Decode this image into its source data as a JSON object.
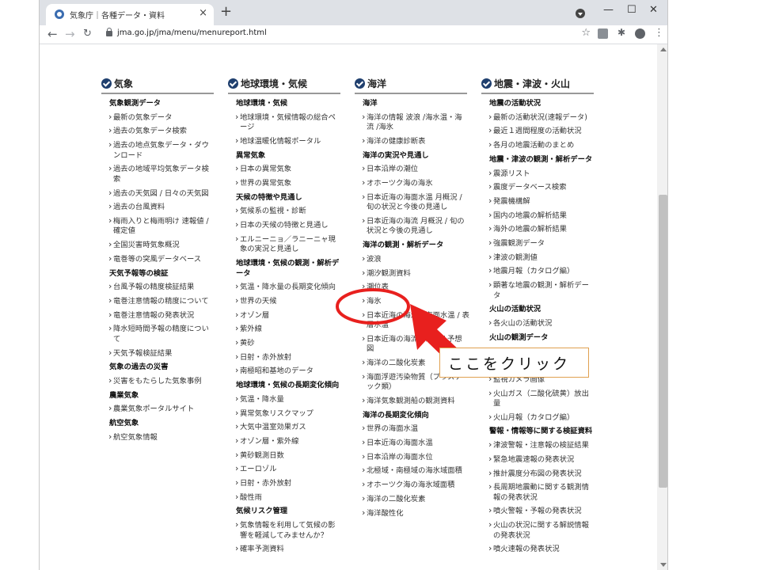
{
  "browser": {
    "tab_title": "気象庁｜各種データ・資料",
    "tab_close": "×",
    "new_tab": "+",
    "url": "jma.go.jp/jma/menu/menureport.html",
    "controls": {
      "minimize": "—",
      "maximize": "☐",
      "close": "✕"
    },
    "nav": {
      "back": "←",
      "forward": "→",
      "reload": "C"
    },
    "star": "☆",
    "menu": "⋮",
    "puzzle": "✱"
  },
  "columns": [
    {
      "title": "気象",
      "items": [
        {
          "type": "cat",
          "text": "気象観測データ"
        },
        {
          "type": "link",
          "text": "最新の気象データ"
        },
        {
          "type": "link",
          "text": "過去の気象データ検索"
        },
        {
          "type": "link",
          "text": "過去の地点気象データ・ダウ"
        },
        {
          "type": "cont",
          "text": "ンロード"
        },
        {
          "type": "link",
          "text": "過去の地域平均気象データ検"
        },
        {
          "type": "cont",
          "text": "索"
        },
        {
          "type": "link",
          "text": "過去の天気図 / 日々の天気図"
        },
        {
          "type": "link",
          "text": "過去の台風資料"
        },
        {
          "type": "link",
          "text": "梅雨入りと梅雨明け 速報値 /"
        },
        {
          "type": "cont",
          "text": "確定値"
        },
        {
          "type": "link",
          "text": "全国災害時気象概況"
        },
        {
          "type": "link",
          "text": "竜巻等の突風データベース"
        },
        {
          "type": "cat",
          "text": "天気予報等の検証"
        },
        {
          "type": "link",
          "text": "台風予報の精度検証結果"
        },
        {
          "type": "link",
          "text": "竜巻注意情報の精度について"
        },
        {
          "type": "link",
          "text": "竜巻注意情報の発表状況"
        },
        {
          "type": "link",
          "text": "降水短時間予報の精度につい"
        },
        {
          "type": "cont",
          "text": "て"
        },
        {
          "type": "link",
          "text": "天気予報検証結果"
        },
        {
          "type": "cat",
          "text": "気象の過去の災害"
        },
        {
          "type": "link",
          "text": "災害をもたらした気象事例"
        },
        {
          "type": "cat",
          "text": "農業気象"
        },
        {
          "type": "link",
          "text": "農業気象ポータルサイト"
        },
        {
          "type": "cat",
          "text": "航空気象"
        },
        {
          "type": "link",
          "text": "航空気象情報"
        }
      ]
    },
    {
      "title": "地球環境・気候",
      "items": [
        {
          "type": "cat",
          "text": "地球環境・気候"
        },
        {
          "type": "link",
          "text": "地球環境・気候情報の総合ペ"
        },
        {
          "type": "cont",
          "text": "ージ"
        },
        {
          "type": "link",
          "text": "地球温暖化情報ポータル"
        },
        {
          "type": "cat",
          "text": "異常気象"
        },
        {
          "type": "link",
          "text": "日本の異常気象"
        },
        {
          "type": "link",
          "text": "世界の異常気象"
        },
        {
          "type": "cat",
          "text": "天候の特徴や見通し"
        },
        {
          "type": "link",
          "text": "気候系の監視・診断"
        },
        {
          "type": "link",
          "text": "日本の天候の特徴と見通し"
        },
        {
          "type": "link",
          "text": "エルニーニョ／ラニーニャ現"
        },
        {
          "type": "cont",
          "text": "象の実況と見通し"
        },
        {
          "type": "cat",
          "text": "地球環境・気候の観測・解析デ"
        },
        {
          "type": "catc",
          "text": "ータ"
        },
        {
          "type": "link",
          "text": "気温・降水量の長期変化傾向"
        },
        {
          "type": "link",
          "text": "世界の天候"
        },
        {
          "type": "link",
          "text": "オゾン層"
        },
        {
          "type": "link",
          "text": "紫外線"
        },
        {
          "type": "link",
          "text": "黄砂"
        },
        {
          "type": "link",
          "text": "日射・赤外放射"
        },
        {
          "type": "link",
          "text": "南極昭和基地のデータ"
        },
        {
          "type": "cat",
          "text": "地球環境・気候の長期変化傾向"
        },
        {
          "type": "link",
          "text": "気温・降水量"
        },
        {
          "type": "link",
          "text": "異常気象リスクマップ"
        },
        {
          "type": "link",
          "text": "大気中温室効果ガス"
        },
        {
          "type": "link",
          "text": "オゾン層・紫外線"
        },
        {
          "type": "link",
          "text": "黄砂観測日数"
        },
        {
          "type": "link",
          "text": "エーロゾル"
        },
        {
          "type": "link",
          "text": "日射・赤外放射"
        },
        {
          "type": "link",
          "text": "酸性雨"
        },
        {
          "type": "cat",
          "text": "気候リスク管理"
        },
        {
          "type": "link",
          "text": "気象情報を利用して気候の影"
        },
        {
          "type": "cont",
          "text": "響を軽減してみませんか？"
        },
        {
          "type": "link",
          "text": "確率予測資料"
        }
      ]
    },
    {
      "title": "海洋",
      "items": [
        {
          "type": "cat",
          "text": "海洋"
        },
        {
          "type": "link",
          "text": "海洋の情報 波浪 /海水温・海"
        },
        {
          "type": "cont",
          "text": "流 /海氷"
        },
        {
          "type": "link",
          "text": "海洋の健康診断表"
        },
        {
          "type": "cat",
          "text": "海洋の実況や見通し"
        },
        {
          "type": "link",
          "text": "日本沿岸の潮位"
        },
        {
          "type": "link",
          "text": "オホーツク海の海氷"
        },
        {
          "type": "link",
          "text": "日本近海の海面水温 月概況 /"
        },
        {
          "type": "cont",
          "text": "旬の状況と今後の見通し"
        },
        {
          "type": "link",
          "text": "日本近海の海流 月概況 / 旬の"
        },
        {
          "type": "cont",
          "text": "状況と今後の見通し"
        },
        {
          "type": "cat",
          "text": "海洋の観測・解析データ"
        },
        {
          "type": "link",
          "text": "波浪"
        },
        {
          "type": "link",
          "text": "潮汐観測資料"
        },
        {
          "type": "link",
          "text": "潮位表"
        },
        {
          "type": "link",
          "text": "海氷"
        },
        {
          "type": "link",
          "text": "日本近海の海流・海面水温 / 表"
        },
        {
          "type": "cont",
          "text": "層水温"
        },
        {
          "type": "link",
          "text": "日本近海の海流・海氷 / 予想"
        },
        {
          "type": "cont",
          "text": "図"
        },
        {
          "type": "link",
          "text": "海洋の二酸化炭素"
        },
        {
          "type": "link",
          "text": "海面浮遊汚染物質（プラスチ"
        },
        {
          "type": "cont",
          "text": "ック類）"
        },
        {
          "type": "link",
          "text": "海洋気象観測船の観測資料"
        },
        {
          "type": "cat",
          "text": "海洋の長期変化傾向"
        },
        {
          "type": "link",
          "text": "世界の海面水温"
        },
        {
          "type": "link",
          "text": "日本近海の海面水温"
        },
        {
          "type": "link",
          "text": "日本沿岸の海面水位"
        },
        {
          "type": "link",
          "text": "北極域・南極域の海氷域面積"
        },
        {
          "type": "link",
          "text": "オホーツク海の海氷域面積"
        },
        {
          "type": "link",
          "text": "海洋の二酸化炭素"
        },
        {
          "type": "link",
          "text": "海洋酸性化"
        }
      ]
    },
    {
      "title": "地震・津波・火山",
      "items": [
        {
          "type": "cat",
          "text": "地震の活動状況"
        },
        {
          "type": "link",
          "text": "最新の活動状況(速報データ)"
        },
        {
          "type": "link",
          "text": "最近１週間程度の活動状況"
        },
        {
          "type": "link",
          "text": "各月の地震活動のまとめ"
        },
        {
          "type": "cat",
          "text": "地震・津波の観測・解析データ"
        },
        {
          "type": "link",
          "text": "震源リスト"
        },
        {
          "type": "link",
          "text": "震度データベース検索"
        },
        {
          "type": "link",
          "text": "発震機構解"
        },
        {
          "type": "link",
          "text": "国内の地震の解析結果"
        },
        {
          "type": "link",
          "text": "海外の地震の解析結果"
        },
        {
          "type": "link",
          "text": "強震観測データ"
        },
        {
          "type": "link",
          "text": "津波の観測値"
        },
        {
          "type": "link",
          "text": "地震月報（カタログ編）"
        },
        {
          "type": "link",
          "text": "顕著な地震の観測・解析デー"
        },
        {
          "type": "cont",
          "text": "タ"
        },
        {
          "type": "cat",
          "text": "火山の活動状況"
        },
        {
          "type": "link",
          "text": "各火山の活動状況"
        },
        {
          "type": "cat",
          "text": "火山の観測データ"
        },
        {
          "type": "link",
          "text": ""
        },
        {
          "type": "link",
          "text": ""
        },
        {
          "type": "link",
          "text": "監視カメラ画像"
        },
        {
          "type": "link",
          "text": "火山ガス（二酸化硫黄）放出"
        },
        {
          "type": "cont",
          "text": "量"
        },
        {
          "type": "link",
          "text": "火山月報（カタログ編）"
        },
        {
          "type": "cat",
          "text": "警報・情報等に関する検証資料"
        },
        {
          "type": "link",
          "text": "津波警報・注意報の検証結果"
        },
        {
          "type": "link",
          "text": "緊急地震速報の発表状況"
        },
        {
          "type": "link",
          "text": "推計震度分布図の発表状況"
        },
        {
          "type": "link",
          "text": "長周期地震動に関する観測情"
        },
        {
          "type": "cont",
          "text": "報の発表状況"
        },
        {
          "type": "link",
          "text": "噴火警報・予報の発表状況"
        },
        {
          "type": "link",
          "text": "火山の状況に関する解説情報"
        },
        {
          "type": "cont",
          "text": "の発表状況"
        },
        {
          "type": "link",
          "text": "噴火速報の発表状況"
        }
      ]
    }
  ],
  "annotation": {
    "callout_text": "ここをクリック",
    "highlight_color": "#e8201e",
    "callout_border": "#e0a050"
  }
}
